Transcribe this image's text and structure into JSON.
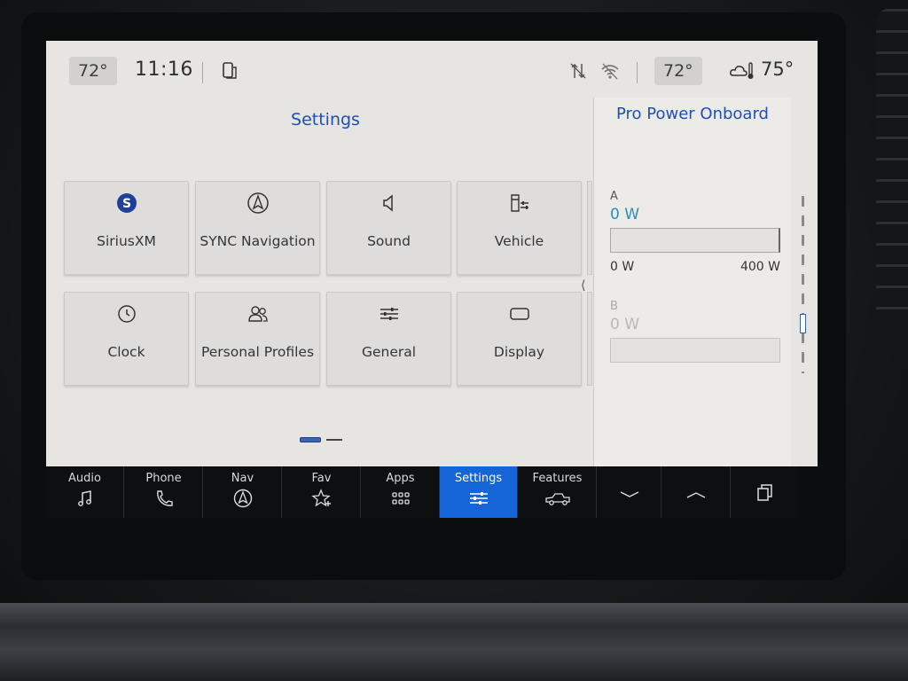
{
  "status_bar": {
    "driver_temp": "72°",
    "time": "11:16",
    "passenger_temp": "72°",
    "outside_temp": "75°",
    "icons": [
      "phone-projection-icon",
      "data-transfer-icon",
      "wifi-icon",
      "weather-cloud-thermometer-icon"
    ]
  },
  "settings": {
    "title": "Settings",
    "tiles": [
      {
        "label": "SiriusXM",
        "icon": "siriusxm-icon"
      },
      {
        "label": "SYNC Navigation",
        "icon": "navigation-icon"
      },
      {
        "label": "Sound",
        "icon": "speaker-icon"
      },
      {
        "label": "Vehicle",
        "icon": "vehicle-settings-icon"
      },
      {
        "label": "Clock",
        "icon": "clock-icon"
      },
      {
        "label": "Personal Profiles",
        "icon": "profiles-icon"
      },
      {
        "label": "General",
        "icon": "sliders-icon"
      },
      {
        "label": "Display",
        "icon": "display-icon"
      }
    ],
    "page_indicator": {
      "current": 1,
      "total": 2
    }
  },
  "pro_power": {
    "title": "Pro Power Onboard",
    "channel_a": {
      "label": "A",
      "value": "0 W",
      "min": "0 W",
      "max": "400 W",
      "level": 0
    },
    "channel_b": {
      "label": "B",
      "value": "0 W",
      "level": 0
    }
  },
  "dock": {
    "items": [
      {
        "label": "Audio",
        "icon": "music-note-icon"
      },
      {
        "label": "Phone",
        "icon": "phone-icon"
      },
      {
        "label": "Nav",
        "icon": "navigation-icon"
      },
      {
        "label": "Fav",
        "icon": "star-plus-icon"
      },
      {
        "label": "Apps",
        "icon": "apps-grid-icon"
      },
      {
        "label": "Settings",
        "icon": "settings-sliders-icon",
        "active": true
      },
      {
        "label": "Features",
        "icon": "truck-icon"
      }
    ],
    "controls": [
      "chevron-down-icon",
      "chevron-up-icon",
      "copy-windows-icon"
    ]
  },
  "colors": {
    "accent": "#1f4fb4",
    "active_tab": "#1565d8",
    "screen_background": "#e6e5e1",
    "power_value": "#2a8fb0"
  }
}
